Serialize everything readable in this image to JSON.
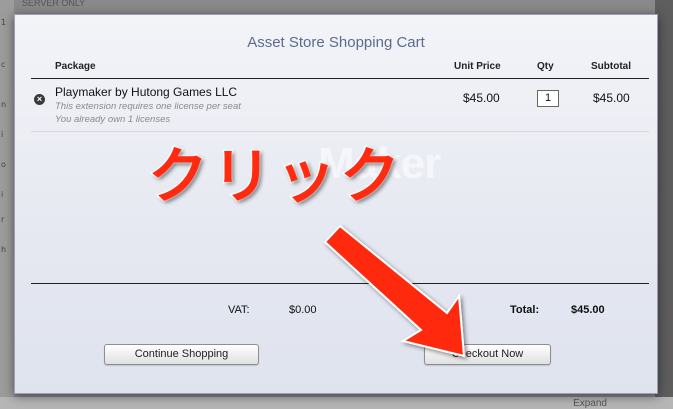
{
  "background": {
    "top_text": "SERVER ONLY",
    "left_text_fragments": [
      "1",
      "c",
      "n",
      "i",
      "o",
      "i",
      "r",
      "h"
    ],
    "expand_label": "Expand",
    "watermark_text": "Maker"
  },
  "dialog": {
    "title": "Asset Store Shopping Cart",
    "columns": {
      "package": "Package",
      "unit_price": "Unit Price",
      "qty": "Qty",
      "subtotal": "Subtotal"
    },
    "items": [
      {
        "name": "Playmaker by Hutong Games LLC",
        "notes": [
          "This extension requires one license per seat",
          "You already own 1 licenses"
        ],
        "unit_price": "$45.00",
        "qty": "1",
        "subtotal": "$45.00",
        "remove_icon": "remove-circle-icon"
      }
    ],
    "vat_label": "VAT:",
    "vat_value": "$0.00",
    "total_label": "Total:",
    "total_value": "$45.00",
    "continue_label": "Continue Shopping",
    "checkout_label": "Checkout Now"
  },
  "annotation": {
    "text": "クリック",
    "color": "#ff2a10"
  }
}
